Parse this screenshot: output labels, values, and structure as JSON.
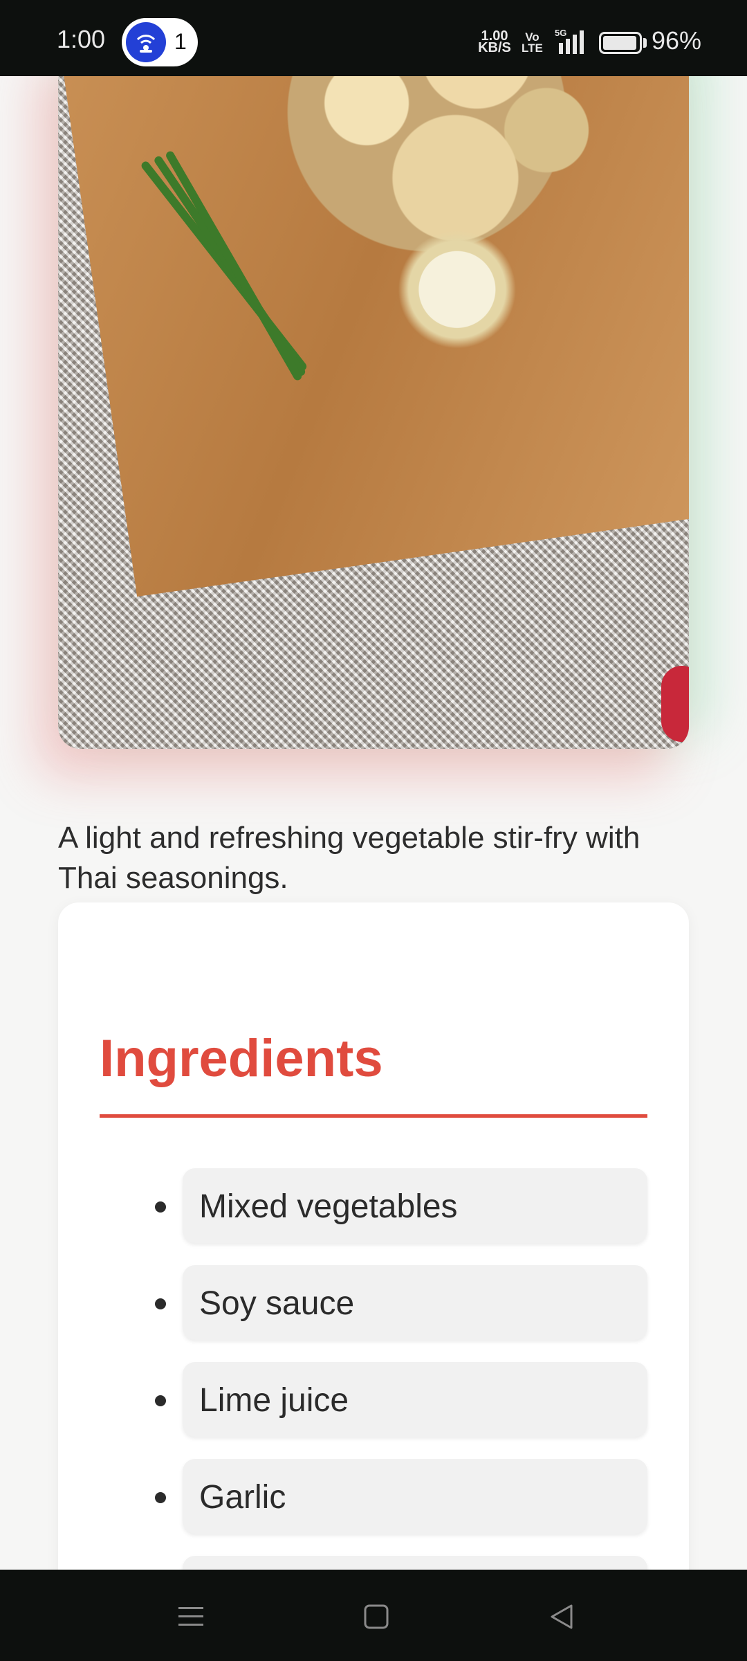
{
  "status_bar": {
    "time": "1:00",
    "hotspot_count": "1",
    "net_speed_value": "1.00",
    "net_speed_unit": "KB/S",
    "volte_top": "Vo",
    "volte_bottom": "LTE",
    "network_type": "5G",
    "battery_level": 0.96,
    "battery_percent": "96%"
  },
  "recipe": {
    "description": "A light and refreshing vegetable stir-fry with Thai seasonings."
  },
  "ingredients": {
    "title": "Ingredients",
    "items": [
      "Mixed vegetables",
      "Soy sauce",
      "Lime juice",
      "Garlic"
    ]
  },
  "nav_bar": {
    "icons": [
      "menu-icon",
      "home-icon",
      "back-icon"
    ]
  }
}
